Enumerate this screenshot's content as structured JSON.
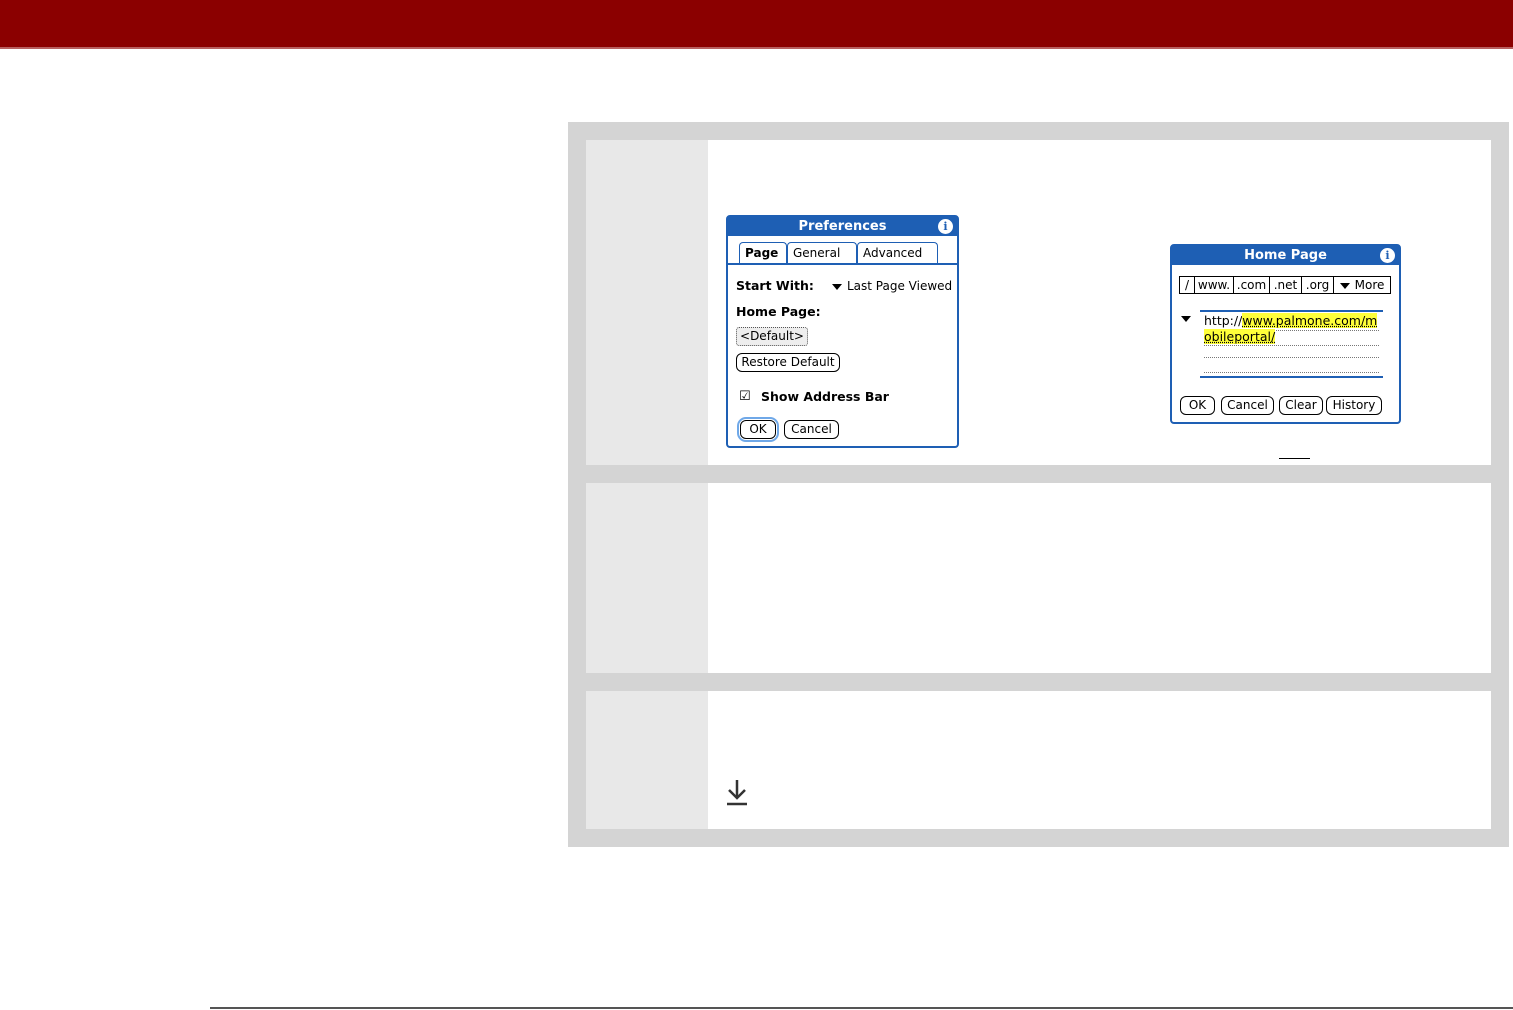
{
  "header": {
    "bar_color": "#8b0000"
  },
  "steps": [
    {
      "preferences_dialog": {
        "title": "Preferences",
        "tabs": [
          "Page",
          "General",
          "Advanced"
        ],
        "start_with_label": "Start With:",
        "start_with_value": "Last Page Viewed",
        "home_page_label": "Home Page:",
        "home_page_value": "<Default>",
        "restore_default_label": "Restore Default",
        "show_address_bar_label": "Show Address Bar",
        "show_address_bar_checked": true,
        "ok_label": "OK",
        "cancel_label": "Cancel"
      },
      "home_page_dialog": {
        "title": "Home Page",
        "shortcuts": [
          "/",
          "www.",
          ".com",
          ".net",
          ".org"
        ],
        "more_label": "More",
        "url_prefix": "http://",
        "url_line1_highlight": "www.palmone.com/m",
        "url_line2_highlight": "obileportal/",
        "buttons": [
          "OK",
          "Cancel",
          "Clear",
          "History"
        ]
      }
    },
    {},
    {
      "icon": "download-arrow-icon"
    }
  ],
  "colors": {
    "palm_blue": "#1e5fb4",
    "highlight": "#ffff3a",
    "panel_gray": "#d4d4d4"
  }
}
